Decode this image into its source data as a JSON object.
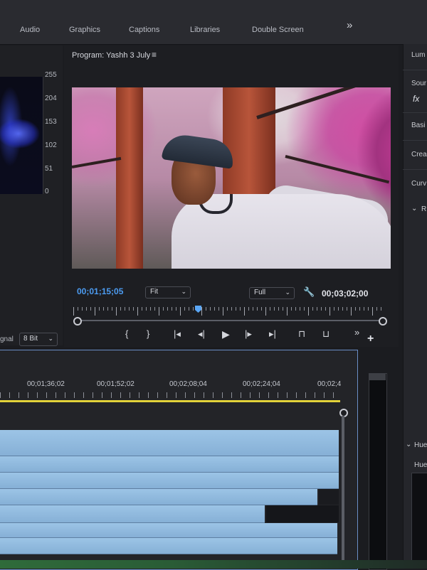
{
  "workspace_tabs": [
    "Audio",
    "Graphics",
    "Captions",
    "Libraries",
    "Double Screen"
  ],
  "workspace_overflow": "»",
  "scopes": {
    "scale": [
      "255",
      "204",
      "153",
      "102",
      "51",
      "0"
    ],
    "signal_label": "gnal",
    "bit_depth": "8 Bit"
  },
  "program_monitor": {
    "title": "Program: Yashh 3 July",
    "menu_icon": "≡",
    "current_timecode": "00;01;15;05",
    "zoom": "Fit",
    "resolution": "Full",
    "duration_timecode": "00;03;02;00",
    "playhead_fraction": 0.4
  },
  "transport": {
    "mark_in": "{",
    "mark_out": "}",
    "go_to_in": "|◂",
    "step_back": "◂|",
    "play": "▶",
    "step_forward": "|▸",
    "go_to_out": "▸|",
    "overflow": "»",
    "add": "+"
  },
  "right_panel": {
    "items": [
      "Lum",
      "Sour",
      "Basi",
      "Crea",
      "Curv",
      "R",
      "Hue",
      "Hue"
    ],
    "fx": "fx"
  },
  "timeline": {
    "timecodes": [
      "00;01;36;02",
      "00;01;52;02",
      "00;02;08;04",
      "00;02;24;04",
      "00;02;4"
    ]
  },
  "colors": {
    "accent_blue": "#4c9cf2",
    "work_area": "#e2d23a",
    "clip": "#9cc4e6"
  }
}
